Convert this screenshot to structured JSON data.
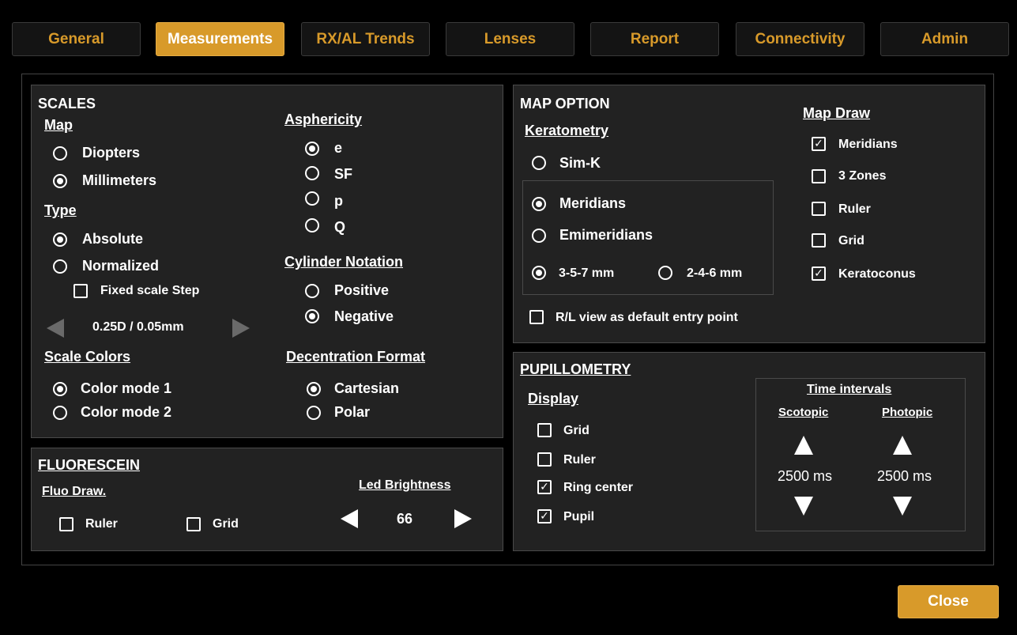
{
  "tabs": [
    {
      "label": "General",
      "active": false
    },
    {
      "label": "Measurements",
      "active": true
    },
    {
      "label": "RX/AL Trends",
      "active": false
    },
    {
      "label": "Lenses",
      "active": false
    },
    {
      "label": "Report",
      "active": false
    },
    {
      "label": "Connectivity",
      "active": false
    },
    {
      "label": "Admin",
      "active": false
    }
  ],
  "colors": {
    "accent": "#d89a2a",
    "panel_bg": "#222222",
    "page_bg": "#000000"
  },
  "scales": {
    "title": "SCALES",
    "map": {
      "label": "Map",
      "options": [
        {
          "label": "Diopters",
          "selected": false
        },
        {
          "label": "Millimeters",
          "selected": true
        }
      ]
    },
    "type": {
      "label": "Type",
      "options": [
        {
          "label": "Absolute",
          "selected": true
        },
        {
          "label": "Normalized",
          "selected": false
        }
      ]
    },
    "fixed_scale_step": {
      "label": "Fixed scale Step",
      "checked": false
    },
    "step_value": "0.25D / 0.05mm",
    "scale_colors": {
      "label": "Scale Colors",
      "options": [
        {
          "label": "Color mode 1",
          "selected": true
        },
        {
          "label": "Color mode 2",
          "selected": false
        }
      ]
    },
    "asphericity": {
      "label": "Asphericity",
      "options": [
        {
          "label": "e",
          "selected": true
        },
        {
          "label": "SF",
          "selected": false
        },
        {
          "label": "p",
          "selected": false
        },
        {
          "label": "Q",
          "selected": false
        }
      ]
    },
    "cylinder_notation": {
      "label": "Cylinder Notation",
      "options": [
        {
          "label": "Positive",
          "selected": false
        },
        {
          "label": "Negative",
          "selected": true
        }
      ]
    },
    "decentration_format": {
      "label": "Decentration Format",
      "options": [
        {
          "label": "Cartesian",
          "selected": true
        },
        {
          "label": "Polar",
          "selected": false
        }
      ]
    }
  },
  "fluorescein": {
    "title": "FLUORESCEIN",
    "fluo_draw": {
      "label": "Fluo Draw.",
      "ruler": {
        "label": "Ruler",
        "checked": false
      },
      "grid": {
        "label": "Grid",
        "checked": false
      }
    },
    "led_brightness": {
      "label": "Led Brightness",
      "value": "66"
    }
  },
  "map_option": {
    "title": "MAP OPTION",
    "keratometry": {
      "label": "Keratometry",
      "sim_k": {
        "label": "Sim-K",
        "selected": false
      },
      "meridians": {
        "label": "Meridians",
        "selected": true
      },
      "emimeridians": {
        "label": "Emimeridians",
        "selected": false
      },
      "zone_a": {
        "label": "3-5-7 mm",
        "selected": true
      },
      "zone_b": {
        "label": "2-4-6 mm",
        "selected": false
      }
    },
    "map_draw": {
      "label": "Map Draw",
      "items": [
        {
          "label": "Meridians",
          "checked": true
        },
        {
          "label": "3 Zones",
          "checked": false
        },
        {
          "label": "Ruler",
          "checked": false
        },
        {
          "label": "Grid",
          "checked": false
        },
        {
          "label": "Keratoconus",
          "checked": true
        }
      ]
    },
    "rl_view": {
      "label": "R/L view as default entry point",
      "checked": false
    }
  },
  "pupillometry": {
    "title": "PUPILLOMETRY",
    "display": {
      "label": "Display",
      "items": [
        {
          "label": "Grid",
          "checked": false
        },
        {
          "label": "Ruler",
          "checked": false
        },
        {
          "label": "Ring center",
          "checked": true
        },
        {
          "label": "Pupil",
          "checked": true
        }
      ]
    },
    "time_intervals": {
      "label": "Time intervals",
      "scotopic": {
        "label": "Scotopic",
        "value": "2500 ms"
      },
      "photopic": {
        "label": "Photopic",
        "value": "2500 ms"
      }
    }
  },
  "close_label": "Close",
  "check_glyph": "✓"
}
